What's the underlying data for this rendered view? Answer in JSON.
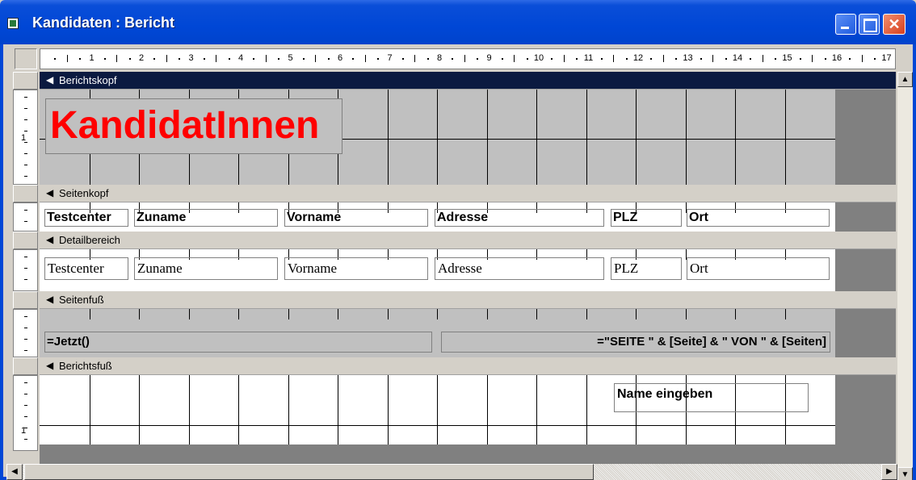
{
  "window": {
    "title": "Kandidaten : Bericht",
    "close_glyph": "✕"
  },
  "ruler": {
    "numbers": [
      "1",
      "2",
      "3",
      "4",
      "5",
      "6",
      "7",
      "8",
      "9",
      "10",
      "11",
      "12",
      "13",
      "14",
      "15",
      "16",
      "17"
    ],
    "vertical_numbers": [
      "1",
      "1"
    ]
  },
  "sections": {
    "report_header": {
      "label": "Berichtskopf",
      "arrow": "◀",
      "title": "KandidatInnen"
    },
    "page_header": {
      "label": "Seitenkopf",
      "arrow": "◀",
      "fields": [
        "Testcenter",
        "Zuname",
        "Vorname",
        "Adresse",
        "PLZ",
        "Ort"
      ]
    },
    "detail": {
      "label": "Detailbereich",
      "arrow": "◀",
      "fields": [
        "Testcenter",
        "Zuname",
        "Vorname",
        "Adresse",
        "PLZ",
        "Ort"
      ]
    },
    "page_footer": {
      "label": "Seitenfuß",
      "arrow": "◀",
      "left_expr": "=Jetzt()",
      "right_expr": "=\"SEITE \" & [Seite] & \" VON \" & [Seiten]"
    },
    "report_footer": {
      "label": "Berichtsfuß",
      "arrow": "◀",
      "field": "Name eingeben"
    }
  },
  "scroll": {
    "up": "▲",
    "down": "▼",
    "left": "◀",
    "right": "▶"
  },
  "colors": {
    "titlebar": "#0047d6",
    "title_text": "#ff0000",
    "active_section": "#0b1a40"
  }
}
